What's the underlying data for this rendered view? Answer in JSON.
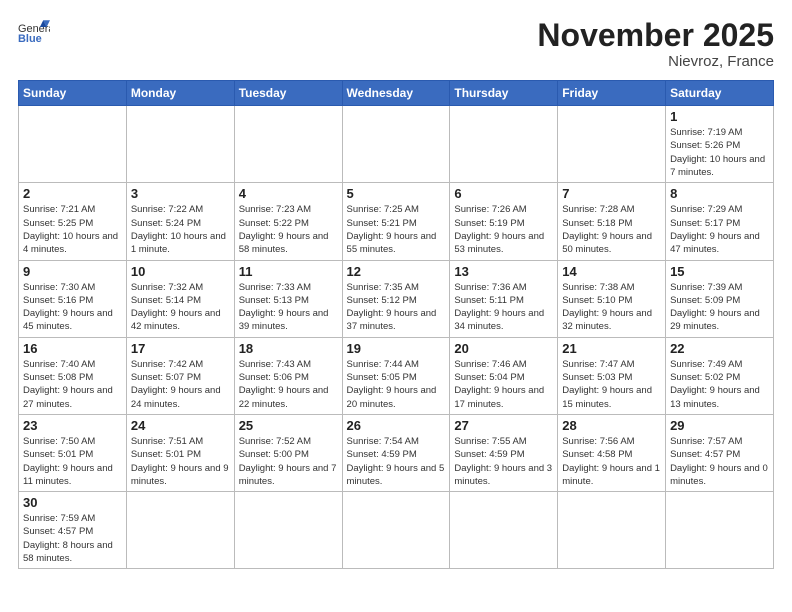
{
  "header": {
    "logo_text_normal": "General",
    "logo_text_bold": "Blue",
    "month_title": "November 2025",
    "subtitle": "Nievroz, France"
  },
  "days_of_week": [
    "Sunday",
    "Monday",
    "Tuesday",
    "Wednesday",
    "Thursday",
    "Friday",
    "Saturday"
  ],
  "weeks": [
    [
      {
        "day": "",
        "info": ""
      },
      {
        "day": "",
        "info": ""
      },
      {
        "day": "",
        "info": ""
      },
      {
        "day": "",
        "info": ""
      },
      {
        "day": "",
        "info": ""
      },
      {
        "day": "",
        "info": ""
      },
      {
        "day": "1",
        "info": "Sunrise: 7:19 AM\nSunset: 5:26 PM\nDaylight: 10 hours and 7 minutes."
      }
    ],
    [
      {
        "day": "2",
        "info": "Sunrise: 7:21 AM\nSunset: 5:25 PM\nDaylight: 10 hours and 4 minutes."
      },
      {
        "day": "3",
        "info": "Sunrise: 7:22 AM\nSunset: 5:24 PM\nDaylight: 10 hours and 1 minute."
      },
      {
        "day": "4",
        "info": "Sunrise: 7:23 AM\nSunset: 5:22 PM\nDaylight: 9 hours and 58 minutes."
      },
      {
        "day": "5",
        "info": "Sunrise: 7:25 AM\nSunset: 5:21 PM\nDaylight: 9 hours and 55 minutes."
      },
      {
        "day": "6",
        "info": "Sunrise: 7:26 AM\nSunset: 5:19 PM\nDaylight: 9 hours and 53 minutes."
      },
      {
        "day": "7",
        "info": "Sunrise: 7:28 AM\nSunset: 5:18 PM\nDaylight: 9 hours and 50 minutes."
      },
      {
        "day": "8",
        "info": "Sunrise: 7:29 AM\nSunset: 5:17 PM\nDaylight: 9 hours and 47 minutes."
      }
    ],
    [
      {
        "day": "9",
        "info": "Sunrise: 7:30 AM\nSunset: 5:16 PM\nDaylight: 9 hours and 45 minutes."
      },
      {
        "day": "10",
        "info": "Sunrise: 7:32 AM\nSunset: 5:14 PM\nDaylight: 9 hours and 42 minutes."
      },
      {
        "day": "11",
        "info": "Sunrise: 7:33 AM\nSunset: 5:13 PM\nDaylight: 9 hours and 39 minutes."
      },
      {
        "day": "12",
        "info": "Sunrise: 7:35 AM\nSunset: 5:12 PM\nDaylight: 9 hours and 37 minutes."
      },
      {
        "day": "13",
        "info": "Sunrise: 7:36 AM\nSunset: 5:11 PM\nDaylight: 9 hours and 34 minutes."
      },
      {
        "day": "14",
        "info": "Sunrise: 7:38 AM\nSunset: 5:10 PM\nDaylight: 9 hours and 32 minutes."
      },
      {
        "day": "15",
        "info": "Sunrise: 7:39 AM\nSunset: 5:09 PM\nDaylight: 9 hours and 29 minutes."
      }
    ],
    [
      {
        "day": "16",
        "info": "Sunrise: 7:40 AM\nSunset: 5:08 PM\nDaylight: 9 hours and 27 minutes."
      },
      {
        "day": "17",
        "info": "Sunrise: 7:42 AM\nSunset: 5:07 PM\nDaylight: 9 hours and 24 minutes."
      },
      {
        "day": "18",
        "info": "Sunrise: 7:43 AM\nSunset: 5:06 PM\nDaylight: 9 hours and 22 minutes."
      },
      {
        "day": "19",
        "info": "Sunrise: 7:44 AM\nSunset: 5:05 PM\nDaylight: 9 hours and 20 minutes."
      },
      {
        "day": "20",
        "info": "Sunrise: 7:46 AM\nSunset: 5:04 PM\nDaylight: 9 hours and 17 minutes."
      },
      {
        "day": "21",
        "info": "Sunrise: 7:47 AM\nSunset: 5:03 PM\nDaylight: 9 hours and 15 minutes."
      },
      {
        "day": "22",
        "info": "Sunrise: 7:49 AM\nSunset: 5:02 PM\nDaylight: 9 hours and 13 minutes."
      }
    ],
    [
      {
        "day": "23",
        "info": "Sunrise: 7:50 AM\nSunset: 5:01 PM\nDaylight: 9 hours and 11 minutes."
      },
      {
        "day": "24",
        "info": "Sunrise: 7:51 AM\nSunset: 5:01 PM\nDaylight: 9 hours and 9 minutes."
      },
      {
        "day": "25",
        "info": "Sunrise: 7:52 AM\nSunset: 5:00 PM\nDaylight: 9 hours and 7 minutes."
      },
      {
        "day": "26",
        "info": "Sunrise: 7:54 AM\nSunset: 4:59 PM\nDaylight: 9 hours and 5 minutes."
      },
      {
        "day": "27",
        "info": "Sunrise: 7:55 AM\nSunset: 4:59 PM\nDaylight: 9 hours and 3 minutes."
      },
      {
        "day": "28",
        "info": "Sunrise: 7:56 AM\nSunset: 4:58 PM\nDaylight: 9 hours and 1 minute."
      },
      {
        "day": "29",
        "info": "Sunrise: 7:57 AM\nSunset: 4:57 PM\nDaylight: 9 hours and 0 minutes."
      }
    ],
    [
      {
        "day": "30",
        "info": "Sunrise: 7:59 AM\nSunset: 4:57 PM\nDaylight: 8 hours and 58 minutes."
      },
      {
        "day": "",
        "info": ""
      },
      {
        "day": "",
        "info": ""
      },
      {
        "day": "",
        "info": ""
      },
      {
        "day": "",
        "info": ""
      },
      {
        "day": "",
        "info": ""
      },
      {
        "day": "",
        "info": ""
      }
    ]
  ]
}
